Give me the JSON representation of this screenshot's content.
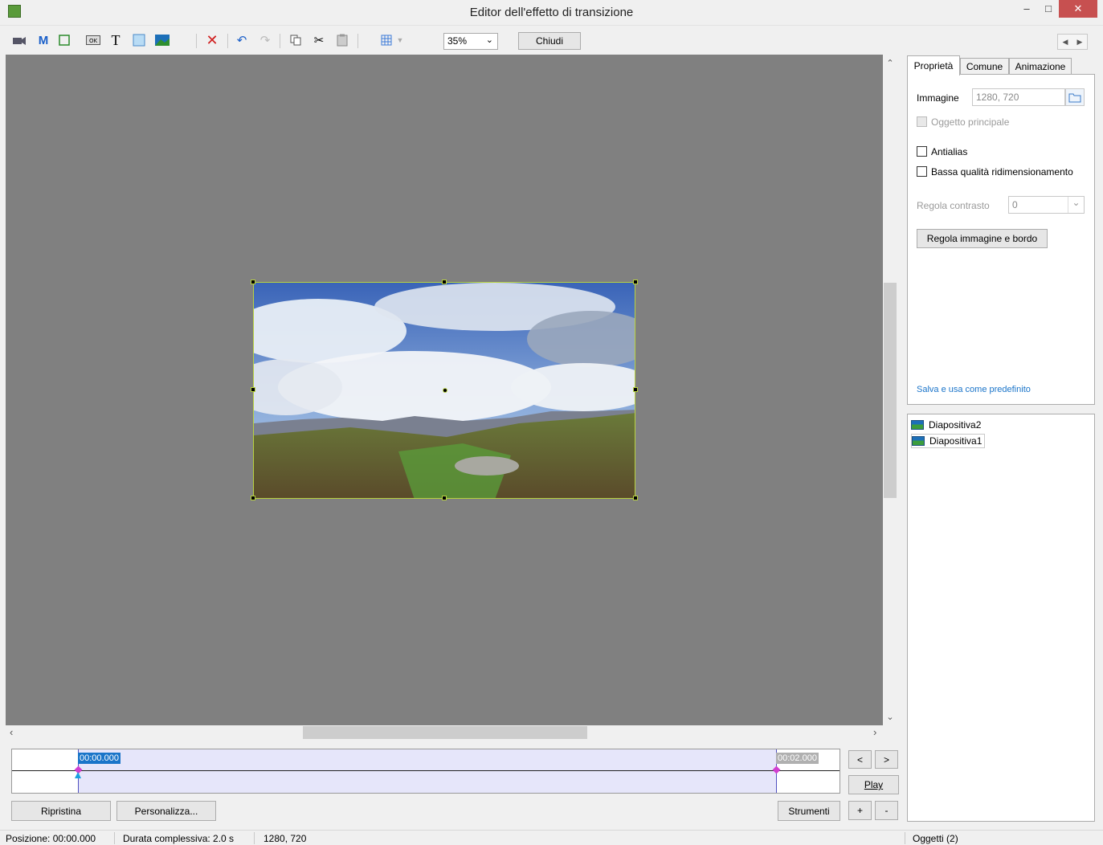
{
  "window": {
    "title": "Editor dell'effetto di transizione"
  },
  "toolbar": {
    "zoom_value": "35%",
    "close_label": "Chiudi",
    "icons": [
      "camera-icon",
      "m-icon",
      "frame-icon",
      "ok-button-icon",
      "text-icon",
      "rectangle-icon",
      "image-icon",
      "delete-icon",
      "undo-icon",
      "redo-icon",
      "copy-icon",
      "cut-icon",
      "paste-icon",
      "grid-icon"
    ]
  },
  "tabs": [
    {
      "label": "Proprietà",
      "active": true
    },
    {
      "label": "Comune",
      "active": false
    },
    {
      "label": "Animazione",
      "active": false
    }
  ],
  "properties": {
    "image_label": "Immagine",
    "image_value": "1280, 720",
    "main_object_label": "Oggetto principale",
    "antialias_label": "Antialias",
    "low_quality_label": "Bassa qualità ridimensionamento",
    "contrast_label": "Regola contrasto",
    "contrast_value": "0",
    "adjust_button": "Regola immagine e bordo",
    "save_default_link": "Salva e usa come predefinito"
  },
  "objects": {
    "items": [
      {
        "label": "Diapositiva2",
        "selected": false
      },
      {
        "label": "Diapositiva1",
        "selected": true
      }
    ],
    "count_label": "Oggetti (2)"
  },
  "timeline": {
    "start_time": "00:00.000",
    "end_time": "00:02.000",
    "prev_label": "<",
    "next_label": ">",
    "play_label": "Play",
    "plus_label": "+",
    "minus_label": "-"
  },
  "bottom_buttons": {
    "reset": "Ripristina",
    "customize": "Personalizza...",
    "tools": "Strumenti"
  },
  "status": {
    "position": "Posizione:  00:00.000",
    "duration": "Durata complessiva:  2.0 s",
    "size": "1280, 720"
  },
  "colors": {
    "canvas": "#808080",
    "selection": "#b8d240",
    "accent": "#1a75c9",
    "close_button": "#c75050"
  }
}
